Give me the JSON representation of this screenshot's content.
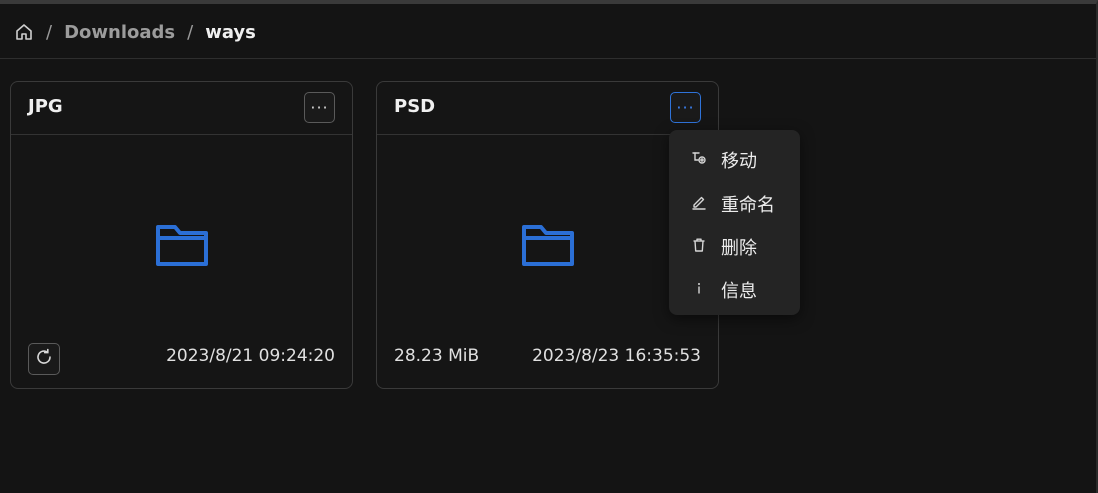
{
  "breadcrumb": {
    "separator": "/",
    "items": [
      "Downloads"
    ],
    "current": "ways"
  },
  "cards": [
    {
      "title": "JPG",
      "size": "",
      "date": "2023/8/21 09:24:20",
      "more_label": "···"
    },
    {
      "title": "PSD",
      "size": "28.23 MiB",
      "date": "2023/8/23 16:35:53",
      "more_label": "···"
    }
  ],
  "context_menu": {
    "items": [
      {
        "label": "移动",
        "icon": "move-icon"
      },
      {
        "label": "重命名",
        "icon": "rename-icon"
      },
      {
        "label": "删除",
        "icon": "delete-icon"
      },
      {
        "label": "信息",
        "icon": "info-icon"
      }
    ]
  },
  "colors": {
    "background": "#141414",
    "accent": "#2f73d9",
    "folder": "#2b6fd6",
    "menu_bg": "#242424"
  }
}
